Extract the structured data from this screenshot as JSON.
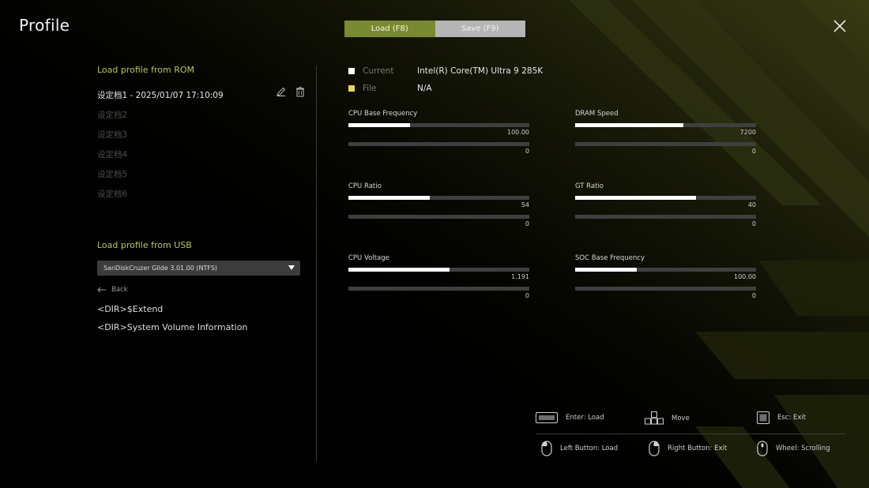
{
  "header": {
    "title": "Profile",
    "close_icon": "close-icon"
  },
  "tabs": [
    {
      "label": "Load (F8)",
      "active": true
    },
    {
      "label": "Save (F9)",
      "active": false
    }
  ],
  "rom": {
    "heading": "Load profile from ROM",
    "items": [
      {
        "label": "设定档1 - 2025/01/07 17:10:09",
        "active": true
      },
      {
        "label": "设定档2",
        "active": false
      },
      {
        "label": "设定档3",
        "active": false
      },
      {
        "label": "设定档4",
        "active": false
      },
      {
        "label": "设定档5",
        "active": false
      },
      {
        "label": "设定档6",
        "active": false
      }
    ],
    "edit_icon": "edit-icon",
    "delete_icon": "trash-icon"
  },
  "usb": {
    "heading": "Load profile from USB",
    "selected_device": "SanDiskCruzer Glide 3.01.00 (NTFS)",
    "back_label": "Back",
    "entries": [
      "<DIR>$Extend",
      "<DIR>System Volume Information"
    ]
  },
  "legend": {
    "current_label": "Current",
    "current_value": "Intel(R) Core(TM) Ultra 9 285K",
    "current_color": "#ffffff",
    "file_label": "File",
    "file_value": "N/A",
    "file_color": "#e8d84a"
  },
  "metrics": [
    {
      "label": "CPU Base Frequency",
      "current_value": "100.00",
      "current_fraction": 0.34,
      "file_value": "0",
      "file_fraction": 0
    },
    {
      "label": "DRAM Speed",
      "current_value": "7200",
      "current_fraction": 0.6,
      "file_value": "0",
      "file_fraction": 0
    },
    {
      "label": "CPU Ratio",
      "current_value": "54",
      "current_fraction": 0.45,
      "file_value": "0",
      "file_fraction": 0
    },
    {
      "label": "GT Ratio",
      "current_value": "40",
      "current_fraction": 0.67,
      "file_value": "0",
      "file_fraction": 0
    },
    {
      "label": "CPU Voltage",
      "current_value": "1.191",
      "current_fraction": 0.56,
      "file_value": "0",
      "file_fraction": 0
    },
    {
      "label": "SOC Base Frequency",
      "current_value": "100.00",
      "current_fraction": 0.34,
      "file_value": "0",
      "file_fraction": 0
    }
  ],
  "hints": [
    {
      "icon": "enter-key-icon",
      "label": "Enter: Load"
    },
    {
      "icon": "arrow-keys-icon",
      "label": "Move"
    },
    {
      "icon": "esc-key-icon",
      "label": "Esc: Exit"
    },
    {
      "icon": "mouse-left-button-icon",
      "label": "Left Button: Load"
    },
    {
      "icon": "mouse-right-button-icon",
      "label": "Right Button: Exit"
    },
    {
      "icon": "mouse-wheel-icon",
      "label": "Wheel: Scrolling"
    }
  ],
  "colors": {
    "accent": "#b8c94a",
    "tab_active": "#7a8a2e",
    "tab_inactive": "#b5b5b5",
    "bar_fill": "#ffffff",
    "bar_track": "#3f3f3f"
  }
}
